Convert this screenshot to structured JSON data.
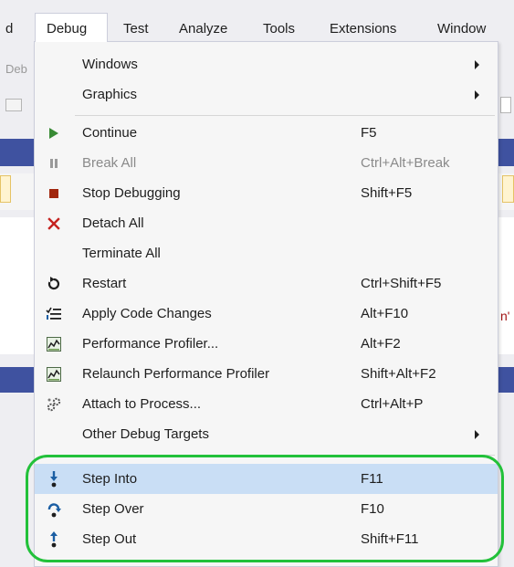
{
  "menubar": {
    "items": [
      "d",
      "Debug",
      "Test",
      "Analyze",
      "Tools",
      "Extensions",
      "Window"
    ]
  },
  "background": {
    "left_fragment": "Deb",
    "right_fragment": "n'"
  },
  "menu": {
    "items": [
      {
        "label": "Windows",
        "shortcut": "",
        "submenu": true,
        "icon": ""
      },
      {
        "label": "Graphics",
        "shortcut": "",
        "submenu": true,
        "icon": ""
      },
      {
        "label": "Continue",
        "shortcut": "F5",
        "icon": "continue-play-icon"
      },
      {
        "label": "Break All",
        "shortcut": "Ctrl+Alt+Break",
        "icon": "pause-icon",
        "disabled": true
      },
      {
        "label": "Stop Debugging",
        "shortcut": "Shift+F5",
        "icon": "stop-square-icon"
      },
      {
        "label": "Detach All",
        "shortcut": "",
        "icon": "detach-x-icon"
      },
      {
        "label": "Terminate All",
        "shortcut": "",
        "icon": ""
      },
      {
        "label": "Restart",
        "shortcut": "Ctrl+Shift+F5",
        "icon": "restart-icon"
      },
      {
        "label": "Apply Code Changes",
        "shortcut": "Alt+F10",
        "icon": "apply-code-changes-icon"
      },
      {
        "label": "Performance Profiler...",
        "shortcut": "Alt+F2",
        "icon": "performance-profiler-icon"
      },
      {
        "label": "Relaunch Performance Profiler",
        "shortcut": "Shift+Alt+F2",
        "icon": "relaunch-profiler-icon"
      },
      {
        "label": "Attach to Process...",
        "shortcut": "Ctrl+Alt+P",
        "icon": "attach-process-gears-icon"
      },
      {
        "label": "Other Debug Targets",
        "shortcut": "",
        "submenu": true,
        "icon": ""
      },
      {
        "label": "Step Into",
        "shortcut": "F11",
        "icon": "step-into-icon",
        "highlighted": true
      },
      {
        "label": "Step Over",
        "shortcut": "F10",
        "icon": "step-over-icon"
      },
      {
        "label": "Step Out",
        "shortcut": "Shift+F11",
        "icon": "step-out-icon"
      }
    ]
  },
  "colors": {
    "highlight": "#c9def5",
    "annotation_oval": "#22c13a",
    "icon_blue": "#1b5ea3",
    "continue_green": "#388a34",
    "stop_red": "#a1260d"
  }
}
